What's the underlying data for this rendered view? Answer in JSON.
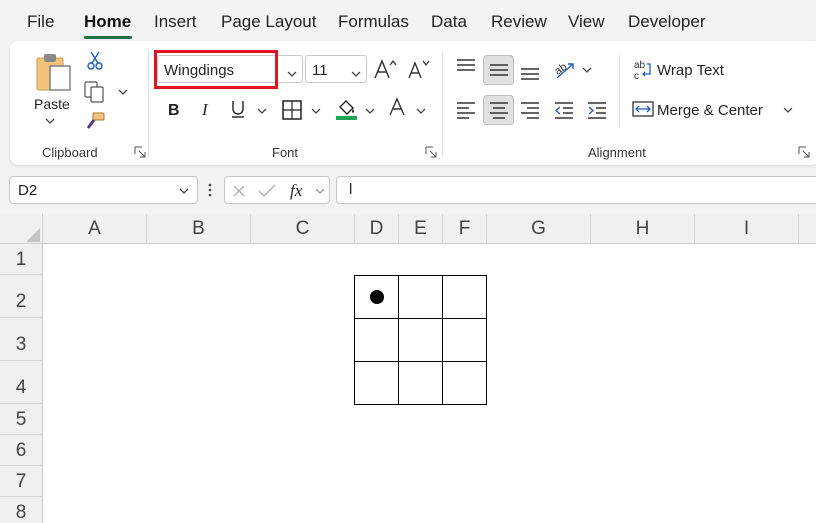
{
  "menu": {
    "items": [
      "File",
      "Home",
      "Insert",
      "Page Layout",
      "Formulas",
      "Data",
      "Review",
      "View",
      "Developer"
    ],
    "active": "Home"
  },
  "ribbon": {
    "clipboard": {
      "label": "Clipboard",
      "paste_label": "Paste"
    },
    "font": {
      "label": "Font",
      "font_name": "Wingdings",
      "font_size": "11"
    },
    "alignment": {
      "label": "Alignment",
      "wrap_text": "Wrap Text",
      "merge_center": "Merge & Center"
    }
  },
  "formula_bar": {
    "name_box": "D2",
    "fx": "fx",
    "formula": "l"
  },
  "sheet": {
    "columns": [
      "A",
      "B",
      "C",
      "D",
      "E",
      "F",
      "G",
      "H",
      "I"
    ],
    "rows": [
      "1",
      "2",
      "3",
      "4",
      "5",
      "6",
      "7",
      "8"
    ],
    "cell_value": "l"
  },
  "colors": {
    "accent": "#1e7145",
    "highlight": "#e0141e",
    "fill_green": "#22a35a"
  }
}
